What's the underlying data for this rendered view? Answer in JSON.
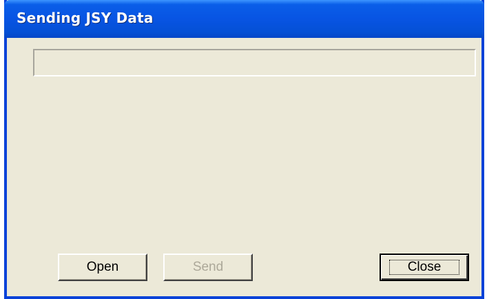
{
  "window": {
    "title": "Sending JSY Data"
  },
  "progress": {
    "value": 0
  },
  "buttons": {
    "open_label": "Open",
    "send_label": "Send",
    "close_label": "Close"
  },
  "colors": {
    "titlebar": "#0854e3",
    "face": "#ece9d8",
    "disabled_text": "#aca899"
  }
}
